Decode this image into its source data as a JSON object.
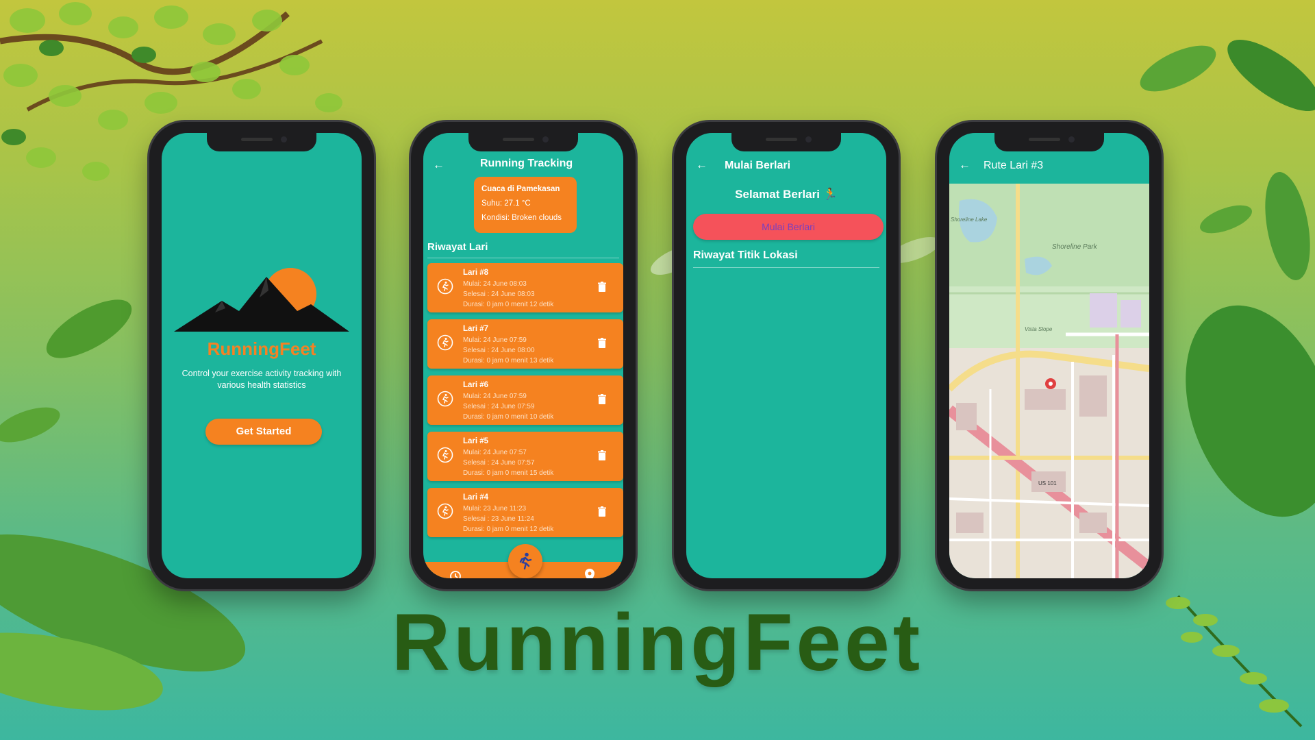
{
  "colors": {
    "teal": "#1cb59c",
    "orange": "#f58220",
    "red_button": "#f5525a",
    "title_green": "#285c14"
  },
  "splash": {
    "brand": "RunningFeet",
    "tagline": "Control your exercise activity tracking with various health statistics",
    "get_started": "Get Started"
  },
  "tracking": {
    "title": "Running Tracking",
    "weather": {
      "city": "Cuaca di Pamekasan",
      "temp": "Suhu: 27.1 °C",
      "condition": "Kondisi: Broken clouds"
    },
    "history_heading": "Riwayat Lari",
    "runs": [
      {
        "title": "Lari #8",
        "start": "Mulai: 24 June 08:03",
        "end": "Selesai : 24 June 08:03",
        "duration": "Durasi: 0 jam 0 menit 12 detik"
      },
      {
        "title": "Lari #7",
        "start": "Mulai: 24 June 07:59",
        "end": "Selesai : 24 June 08:00",
        "duration": "Durasi: 0 jam 0 menit 13 detik"
      },
      {
        "title": "Lari #6",
        "start": "Mulai: 24 June 07:59",
        "end": "Selesai : 24 June 07:59",
        "duration": "Durasi: 0 jam 0 menit 10 detik"
      },
      {
        "title": "Lari #5",
        "start": "Mulai: 24 June 07:57",
        "end": "Selesai : 24 June 07:57",
        "duration": "Durasi: 0 jam 0 menit 15 detik"
      },
      {
        "title": "Lari #4",
        "start": "Mulai: 23 June 11:23",
        "end": "Selesai : 23 June 11:24",
        "duration": "Durasi: 0 jam 0 menit 12 detik"
      }
    ],
    "nav_icons": [
      "history-icon",
      "running-icon",
      "location-pin-icon"
    ]
  },
  "start_run": {
    "title": "Mulai Berlari",
    "greeting": "Selamat Berlari 🏃",
    "start_button": "Mulai Berlari",
    "location_heading": "Riwayat Titik Lokasi"
  },
  "route": {
    "title": "Rute Lari #3",
    "map_labels": {
      "lake": "Shoreline Lake",
      "park": "Shoreline Park",
      "slope": "Vista Slope",
      "highway": "US 101"
    }
  },
  "hero_title": "RunningFeet"
}
